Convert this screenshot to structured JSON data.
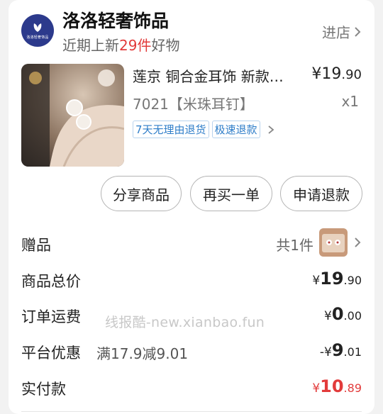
{
  "shop": {
    "logo_text": "洛洛轻奢饰品",
    "name": "洛洛轻奢饰品",
    "subtitle_prefix": "近期上新",
    "subtitle_highlight": "29件",
    "subtitle_suffix": "好物",
    "enter_label": "进店"
  },
  "product": {
    "title": "莲京 铜合金耳饰 新款…",
    "price_symbol": "¥",
    "price_int": "19",
    "price_dec": ".90",
    "sku": "7021【米珠耳钉】",
    "qty": "x1",
    "tags": [
      "7天无理由退货",
      "极速退款"
    ]
  },
  "actions": {
    "share": "分享商品",
    "rebuy": "再买一单",
    "refund": "申请退款"
  },
  "summary": {
    "gift_label": "赠品",
    "gift_count": "共1件",
    "goods_total_label": "商品总价",
    "goods_total": {
      "sym": "¥",
      "int": "19",
      "dec": ".90"
    },
    "shipping_label": "订单运费",
    "shipping": {
      "sym": "¥",
      "int": "0",
      "dec": ".00"
    },
    "discount_label": "平台优惠",
    "discount_rule": "满17.9减9.01",
    "discount": {
      "sym": "-¥",
      "int": "9",
      "dec": ".01"
    },
    "paid_label": "实付款",
    "paid": {
      "sym": "¥",
      "int": "10",
      "dec": ".89"
    }
  },
  "watermark": "线报酷-new.xianbao.fun",
  "colors": {
    "accent_red": "#e23b3b",
    "tag_blue": "#2f7ec9",
    "logo_navy": "#2c3a8c"
  }
}
